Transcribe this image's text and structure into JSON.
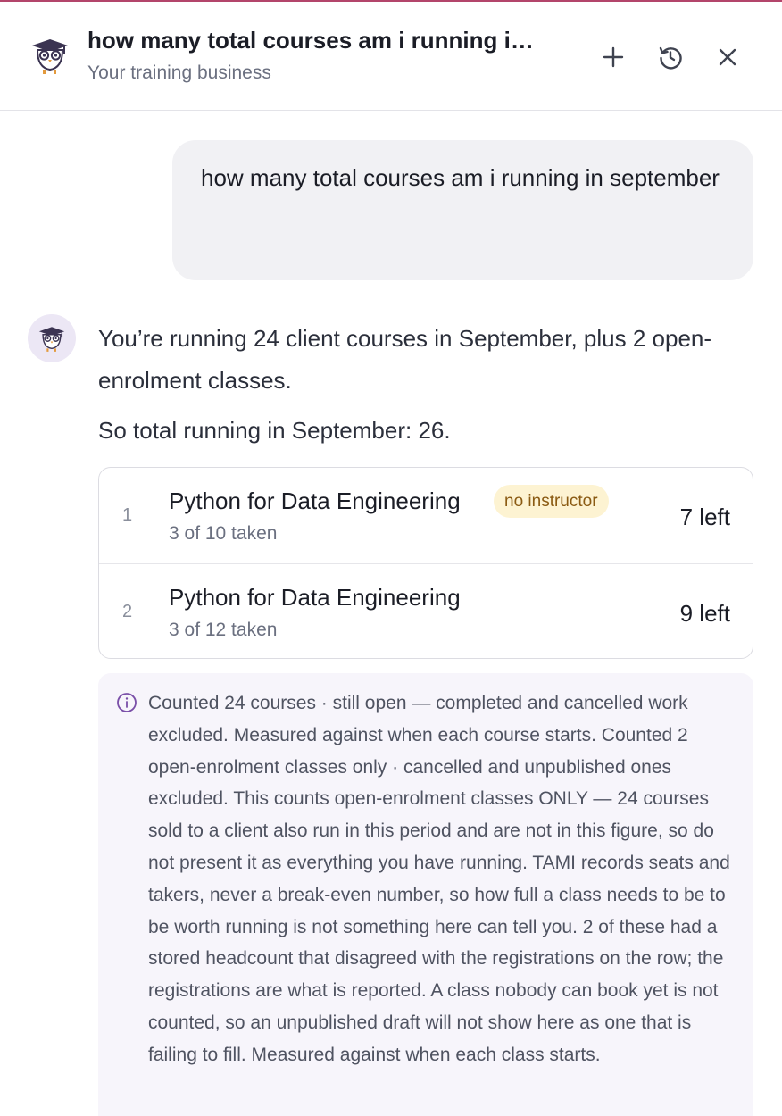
{
  "header": {
    "title": "how many total courses am i running i…",
    "subtitle": "Your training business",
    "icons": {
      "logo": "owl-graduate-logo",
      "new": "plus-icon",
      "history": "history-icon",
      "close": "close-icon"
    }
  },
  "user_message": {
    "text": "how many total courses am i running in september"
  },
  "assistant": {
    "avatar_icon": "owl-graduate-icon",
    "line1": "You’re running 24 client courses in September, plus 2 open-enrolment classes.",
    "line2": "So total running in September: 26.",
    "courses": [
      {
        "index": "1",
        "name": "Python for Data Engineering",
        "badge": "no instructor",
        "taken": "3 of 10 taken",
        "left": "7 left"
      },
      {
        "index": "2",
        "name": "Python for Data Engineering",
        "badge": "",
        "taken": "3 of 12 taken",
        "left": "9 left"
      }
    ],
    "note_icon": "info-icon",
    "note": "Counted 24 courses · still open — completed and cancelled work excluded. Measured against when each course starts. Counted 2 open-enrolment classes only · cancelled and unpublished ones excluded. This counts open-enrolment classes ONLY — 24 courses sold to a client also run in this period and are not in this figure, so do not present it as everything you have running. TAMI records seats and takers, never a break-even number, so how full a class needs to be to be worth running is not something here can tell you. 2 of these had a stored headcount that disagreed with the registrations on the row; the registrations are what is reported. A class nobody can book yet is not counted, so an unpublished draft will not show here as one that is failing to fill. Measured against when each class starts."
  },
  "colors": {
    "accent_bar": "#b3456b",
    "badge_bg": "#fdf3d2",
    "badge_text": "#8a5a12",
    "avatar_bg": "#ece7f5",
    "note_bg": "#f7f5fb",
    "bubble_bg": "#f1f1f4"
  }
}
